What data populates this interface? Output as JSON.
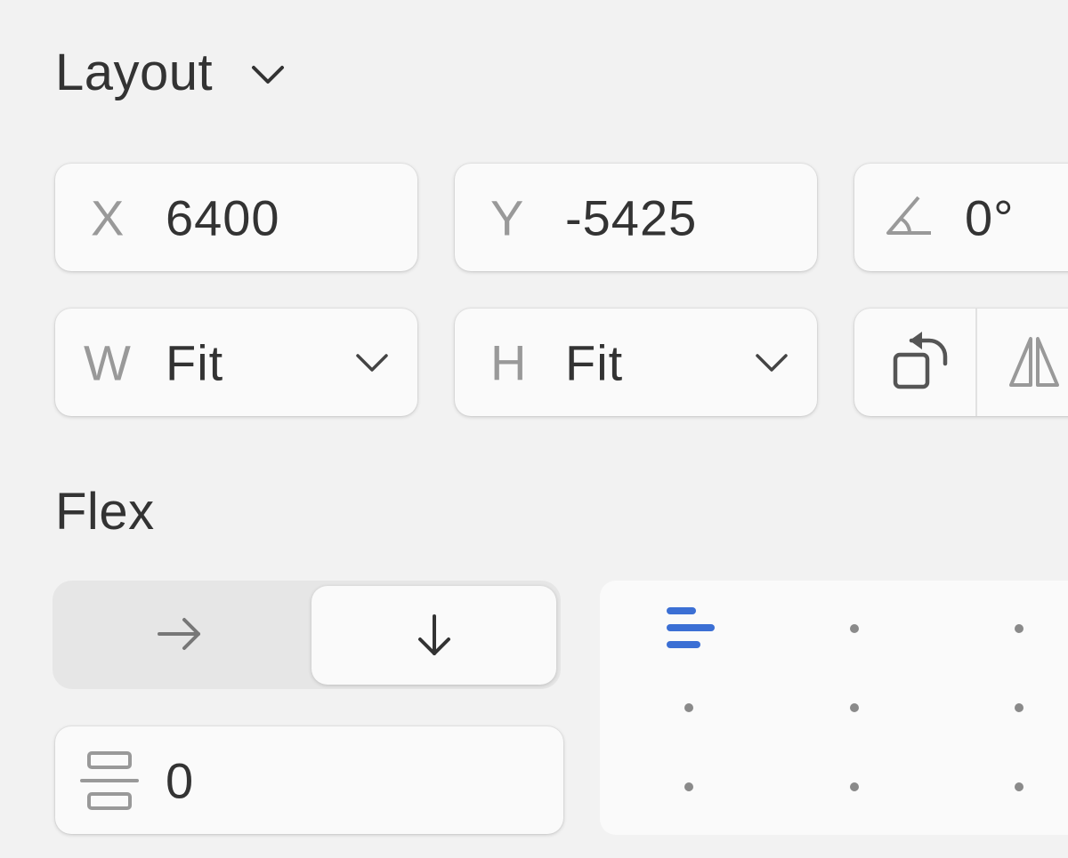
{
  "layout_section": {
    "title": "Layout",
    "x_field": {
      "label": "X",
      "value": "6400"
    },
    "y_field": {
      "label": "Y",
      "value": "-5425"
    },
    "rotation_field": {
      "value": "0°"
    },
    "w_field": {
      "label": "W",
      "value": "Fit"
    },
    "h_field": {
      "label": "H",
      "value": "Fit"
    }
  },
  "flex_section": {
    "title": "Flex",
    "direction_selected": "vertical",
    "gap_value": "0",
    "alignment_selected": "top-left",
    "accent_color": "#3b6fd4"
  }
}
